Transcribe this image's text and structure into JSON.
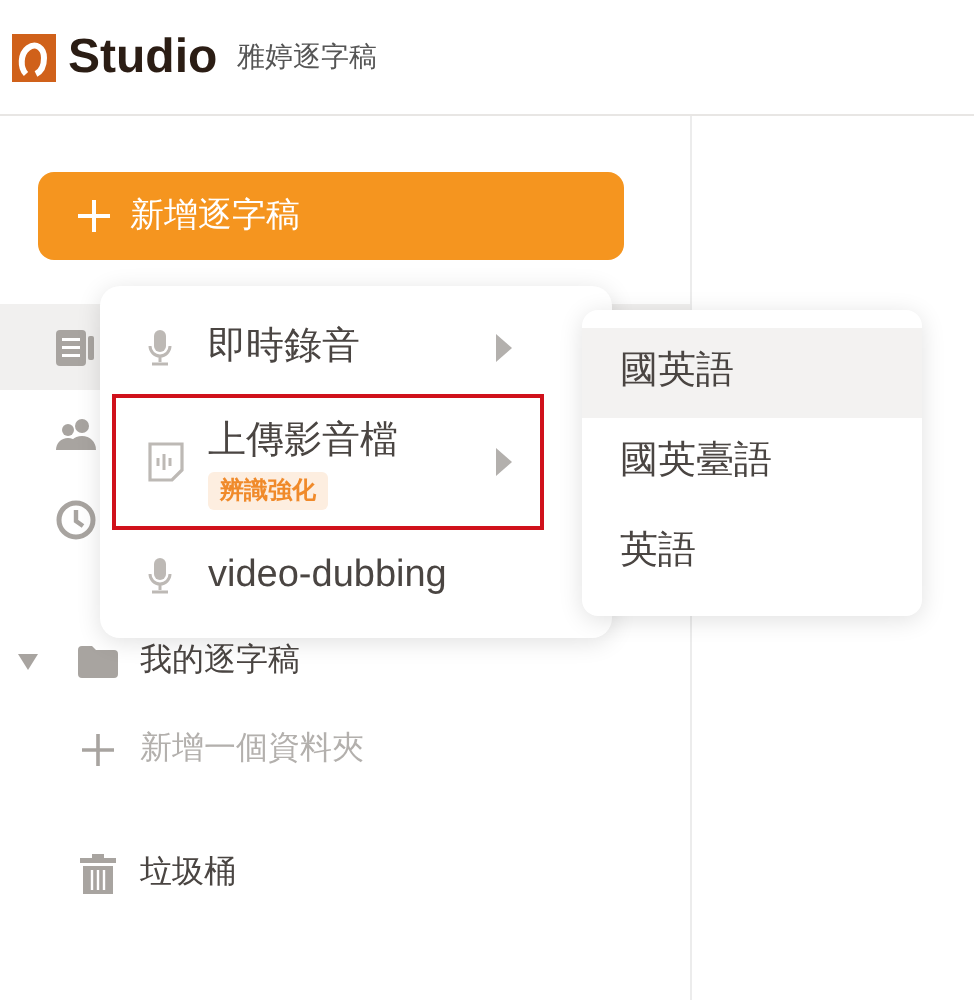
{
  "header": {
    "brand": "Studio",
    "workspace": "雅婷逐字稿"
  },
  "new_button": {
    "label": "新增逐字稿"
  },
  "nav_rows": [
    {
      "kind": "document",
      "selected": true
    },
    {
      "kind": "people",
      "selected": false
    },
    {
      "kind": "clock",
      "selected": false
    }
  ],
  "folders": [
    {
      "kind": "folder",
      "label": "我的逐字稿",
      "expanded": true,
      "muted": false
    },
    {
      "kind": "add",
      "label": "新增一個資料夾",
      "muted": true
    },
    {
      "kind": "trash",
      "label": "垃圾桶",
      "muted": false
    }
  ],
  "menu": {
    "items": [
      {
        "kind": "mic",
        "label": "即時錄音",
        "outlined": false,
        "has_submenu": true
      },
      {
        "kind": "upload",
        "label": "上傳影音檔",
        "badge": "辨識強化",
        "outlined": true,
        "has_submenu": true
      },
      {
        "kind": "mic",
        "label": "video-dubbing",
        "outlined": false,
        "has_submenu": false
      }
    ]
  },
  "submenu": {
    "items": [
      {
        "label": "國英語",
        "selected": true
      },
      {
        "label": "國英臺語",
        "selected": false
      },
      {
        "label": "英語",
        "selected": false
      }
    ]
  }
}
